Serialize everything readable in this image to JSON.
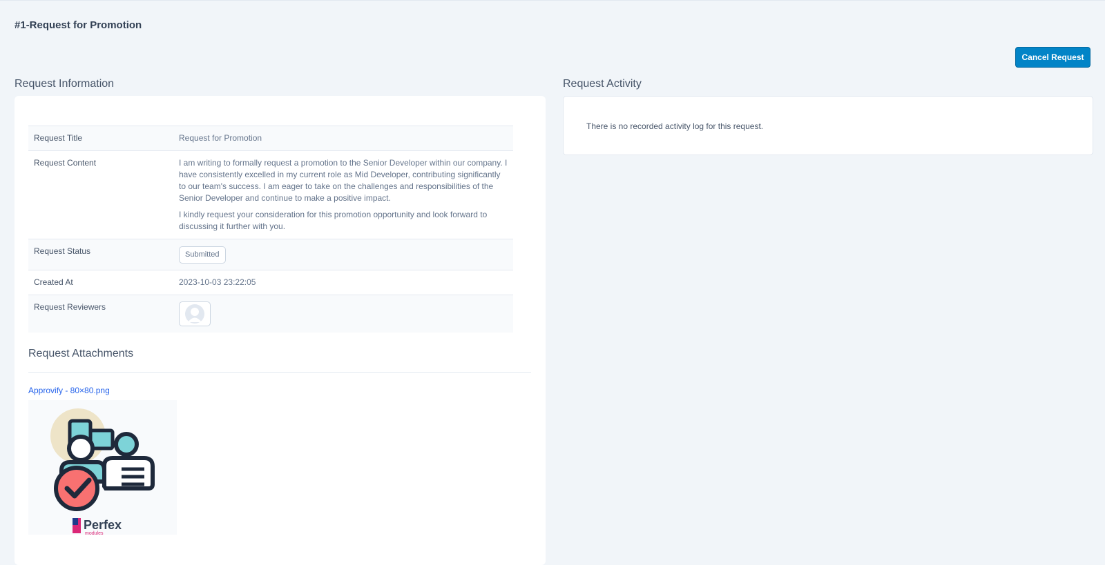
{
  "page": {
    "title": "#1-Request for Promotion",
    "cancel_label": "Cancel Request"
  },
  "info": {
    "heading": "Request Information",
    "rows": {
      "title_label": "Request Title",
      "title_value": "Request for Promotion",
      "content_label": "Request Content",
      "content_p1": "I am writing to formally request a promotion to the Senior Developer within our company. I have consistently excelled in my current role as Mid Developer, contributing significantly to our team's success. I am eager to take on the challenges and responsibilities of the Senior Developer and continue to make a positive impact.",
      "content_p2": "I kindly request your consideration for this promotion opportunity and look forward to discussing it further with you.",
      "status_label": "Request Status",
      "status_value": "Submitted",
      "created_label": "Created At",
      "created_value": "2023-10-03 23:22:05",
      "reviewers_label": "Request Reviewers"
    }
  },
  "attachments": {
    "heading": "Request Attachments",
    "file_name": "Approvify - 80×80.png",
    "logo_text": "Perfex",
    "logo_subtext": "modules"
  },
  "activity": {
    "heading": "Request Activity",
    "empty_text": "There is no recorded activity log for this request."
  },
  "colors": {
    "accent": "#0284c7",
    "link": "#2563eb",
    "background": "#f1f5f9"
  },
  "icons": {
    "reviewer_avatar": "user-avatar-icon",
    "attachment_image": "approvify-logo-image"
  }
}
